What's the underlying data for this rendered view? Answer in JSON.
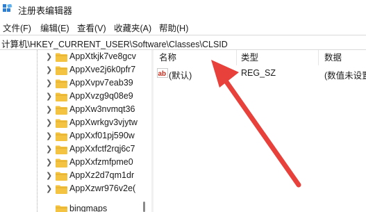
{
  "window": {
    "title": "注册表编辑器"
  },
  "menu": [
    {
      "label": "文件(F)"
    },
    {
      "label": "编辑(E)"
    },
    {
      "label": "查看(V)"
    },
    {
      "label": "收藏夹(A)"
    },
    {
      "label": "帮助(H)"
    }
  ],
  "address": {
    "path": "计算机\\HKEY_CURRENT_USER\\Software\\Classes\\CLSID"
  },
  "tree": {
    "items": [
      {
        "label": "AppXtkjk7ve8gcv"
      },
      {
        "label": "AppXve2j6k0pfr7"
      },
      {
        "label": "AppXvpv7eab39"
      },
      {
        "label": "AppXvzg9q08e9"
      },
      {
        "label": "AppXw3nvmqt36"
      },
      {
        "label": "AppXwrkgv3vjytw"
      },
      {
        "label": "AppXxf01pj590w"
      },
      {
        "label": "AppXxfctf2rqj6c7"
      },
      {
        "label": "AppXxfzmfpme0"
      },
      {
        "label": "AppXz2d7qm1dr"
      },
      {
        "label": "AppXzwr976v2e("
      },
      {
        "label": "bingmaps"
      }
    ]
  },
  "list": {
    "columns": [
      {
        "label": "名称"
      },
      {
        "label": "类型"
      },
      {
        "label": "数据"
      }
    ],
    "rows": [
      {
        "name": "(默认)",
        "type": "REG_SZ",
        "data": "(数值未设置"
      }
    ]
  },
  "colors": {
    "folder": "#f5c342",
    "arrow": "#e8403a",
    "ab_icon": "#c42b1c"
  },
  "icons": {
    "app": "regedit-icon",
    "folder": "folder-icon",
    "value": "string-value-icon",
    "annotation": "red-arrow-icon"
  }
}
